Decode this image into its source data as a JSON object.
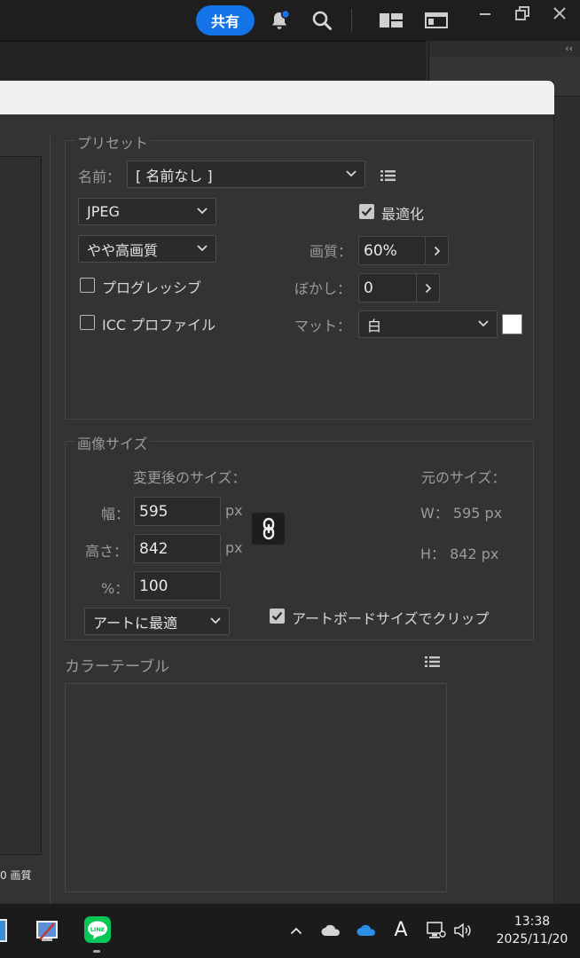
{
  "titlebar": {
    "share_label": "共有",
    "notification_dot_color": "#1473e6"
  },
  "preview": {
    "quality_text": "0 画質"
  },
  "preset": {
    "legend": "プリセット",
    "name_label": "名前：",
    "name_value": "[ 名前なし ]",
    "format_value": "JPEG",
    "quality_preset_value": "やや高画質",
    "optimize_label": "最適化",
    "optimize_checked": true,
    "quality_label": "画質：",
    "quality_value": "60%",
    "progressive_label": "プログレッシブ",
    "progressive_checked": false,
    "blur_label": "ぼかし：",
    "blur_value": "0",
    "icc_label": "ICC プロファイル",
    "icc_checked": false,
    "matte_label": "マット：",
    "matte_value": "白",
    "matte_color": "#ffffff"
  },
  "image_size": {
    "legend": "画像サイズ",
    "new_size_label": "変更後のサイズ：",
    "original_size_label": "元のサイズ：",
    "width_label": "幅：",
    "width_value": "595",
    "height_label": "高さ：",
    "height_value": "842",
    "percent_label": "%：",
    "percent_value": "100",
    "unit_width": "px",
    "unit_height": "px",
    "original_width": "W： 595 px",
    "original_height": "H：  842 px",
    "fit_value": "アートに最適",
    "clip_label": "アートボードサイズでクリップ",
    "clip_checked": true
  },
  "color_table": {
    "legend": "カラーテーブル"
  },
  "taskbar": {
    "time": "13:38",
    "date": "2025/11/20",
    "ime_indicator": "A",
    "line_app_label": "LINE",
    "line_color": "#06c755"
  }
}
